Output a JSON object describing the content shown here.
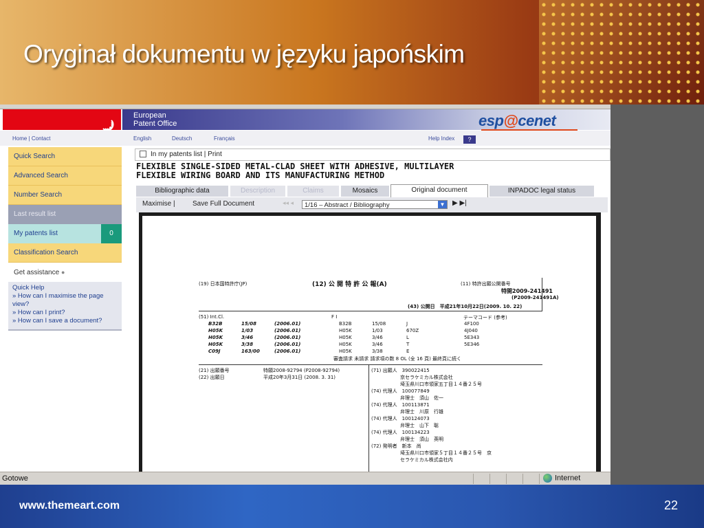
{
  "slide": {
    "title": "Oryginał dokumentu w języku japońskim",
    "footer_url": "www.themeart.com",
    "page_number": "22"
  },
  "browser": {
    "header": {
      "org_line1": "European",
      "org_line2": "Patent Office",
      "brand_prefix": "esp",
      "brand_accent": "@",
      "brand_suffix": "cenet",
      "home_contact": "Home | Contact",
      "lang_english": "English",
      "lang_deutsch": "Deutsch",
      "lang_francais": "Français",
      "help_index": "Help Index",
      "help_q": "?"
    },
    "sidebar": {
      "items": [
        {
          "label": "Quick Search"
        },
        {
          "label": "Advanced Search"
        },
        {
          "label": "Number Search"
        },
        {
          "label": "Last result list"
        },
        {
          "label": "My patents list",
          "badge": "0"
        },
        {
          "label": "Classification Search"
        },
        {
          "label": "Get assistance"
        }
      ],
      "quick_help": {
        "title": "Quick Help",
        "links": [
          "» How can I maximise the page view?",
          "» How can I print?",
          "» How can I save a document?"
        ]
      }
    },
    "main": {
      "patents_list": "In my patents list  |  Print",
      "doc_title_line1": "FLEXIBLE SINGLE-SIDED METAL-CLAD SHEET WITH ADHESIVE, MULTILAYER",
      "doc_title_line2": "FLEXIBLE WIRING BOARD AND ITS MANUFACTURING METHOD",
      "tabs": [
        {
          "label": "Bibliographic data"
        },
        {
          "label": "Description"
        },
        {
          "label": "Claims"
        },
        {
          "label": "Mosaics"
        },
        {
          "label": "Original document"
        },
        {
          "label": "INPADOC legal status"
        }
      ],
      "toolbar": {
        "maximise": "Maximise |",
        "save": "Save Full Document",
        "page_select": "1/16  –  Abstract  /  Bibliography",
        "nav_first_prev": "◂◂ ◂",
        "nav_next_last": "▶ ▶|"
      }
    },
    "document": {
      "h_office": "(19) 日本国特許庁(JP)",
      "h_kind": "(12) 公 開 特 許 公 報(A)",
      "h_pubno_label": "(11) 特許出願公開番号",
      "h_pubno": "特開2009-241491",
      "h_pubno_alt": "(P2009-241491A)",
      "h_date": "(43) 公開日　平成21年10月22日(2009. 10. 22)",
      "ipc_label": "(51) Int.Cl.",
      "fi_label": "F I",
      "theme_label": "テーマコード (参考)",
      "ipc_rows": [
        {
          "code": "B32B",
          "sub": "15/08",
          "ver": "(2006.01)",
          "fi": "B32B",
          "fi_sub": "15/08",
          "fi_x": "J",
          "theme": "4F100"
        },
        {
          "code": "H05K",
          "sub": "1/03",
          "ver": "(2006.01)",
          "fi": "H05K",
          "fi_sub": "1/03",
          "fi_x": "670Z",
          "theme": "4J040"
        },
        {
          "code": "H05K",
          "sub": "3/46",
          "ver": "(2006.01)",
          "fi": "H05K",
          "fi_sub": "3/46",
          "fi_x": "L",
          "theme": "5E343"
        },
        {
          "code": "H05K",
          "sub": "3/38",
          "ver": "(2006.01)",
          "fi": "H05K",
          "fi_sub": "3/46",
          "fi_x": "T",
          "theme": "5E346"
        },
        {
          "code": "C09J",
          "sub": "163/00",
          "ver": "(2006.01)",
          "fi": "H05K",
          "fi_sub": "3/38",
          "fi_x": "E",
          "theme": ""
        }
      ],
      "exam_line": "審査請求 未請求  請求項の数 8  OL  (全 16 頁)   最終頁に続く",
      "app_no_label": "(21) 出願番号",
      "app_no": "特願2008-92794 (P2008-92794)",
      "app_date_label": "(22) 出願日",
      "app_date": "平成20年3月31日 (2008. 3. 31)",
      "right_rows": [
        "(71) 出願人　390022415",
        "　　　　　　京セラケミカル株式会社",
        "　　　　　　埼玉県川口市領家五丁目１４番２５号",
        "(74) 代理人　100077849",
        "　　　　　　弁理士　須山　佐一",
        "(74) 代理人　100113871",
        "　　　　　　弁理士　川原　行雄",
        "(74) 代理人　100124073",
        "　　　　　　弁理士　山下　聡",
        "(74) 代理人　100134223",
        "　　　　　　弁理士　須山　英明",
        "(72) 発明者　新本　尚",
        "　　　　　　埼玉県川口市領家５丁目１４番２５号　京",
        "　　　　　　セラケミカル株式会社内"
      ]
    },
    "status": {
      "left": "Gotowe",
      "zone": "Internet"
    }
  }
}
